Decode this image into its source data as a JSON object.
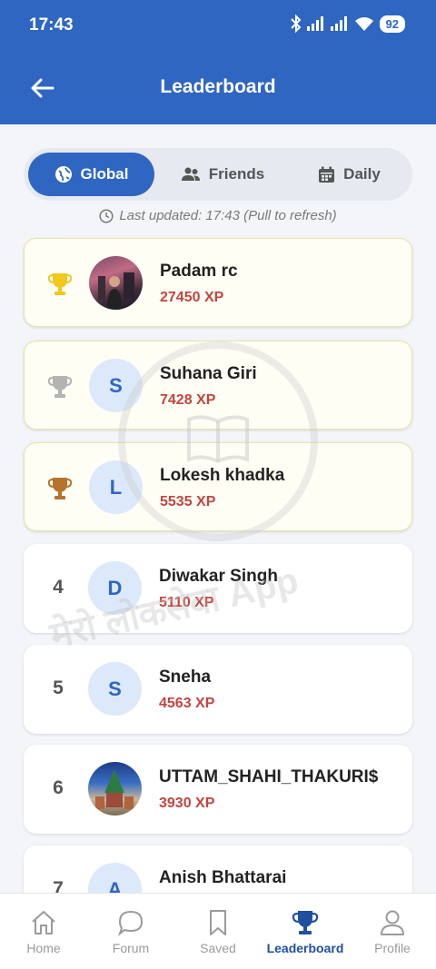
{
  "status_bar": {
    "time": "17:43",
    "battery": "92"
  },
  "app_bar": {
    "title": "Leaderboard"
  },
  "tabs": [
    {
      "label": "Global",
      "active": true
    },
    {
      "label": "Friends",
      "active": false
    },
    {
      "label": "Daily",
      "active": false
    }
  ],
  "last_updated": "Last updated: 17:43 (Pull to refresh)",
  "leaderboard": [
    {
      "rank": "1",
      "trophy": "gold-trophy-icon",
      "avatar": "photo",
      "initial": "",
      "name": "Padam rc",
      "xp": "27450 XP"
    },
    {
      "rank": "2",
      "trophy": "silver-trophy-icon",
      "avatar": "initial",
      "initial": "S",
      "name": "Suhana Giri",
      "xp": "7428 XP"
    },
    {
      "rank": "3",
      "trophy": "bronze-trophy-icon",
      "avatar": "initial",
      "initial": "L",
      "name": "Lokesh khadka",
      "xp": "5535 XP"
    },
    {
      "rank": "4",
      "trophy": "",
      "avatar": "initial",
      "initial": "D",
      "name": "Diwakar Singh",
      "xp": "5110 XP"
    },
    {
      "rank": "5",
      "trophy": "",
      "avatar": "initial",
      "initial": "S",
      "name": "Sneha",
      "xp": "4563 XP"
    },
    {
      "rank": "6",
      "trophy": "",
      "avatar": "photo",
      "initial": "",
      "name": "UTTAM_SHAHI_THAKURI$",
      "xp": "3930 XP"
    },
    {
      "rank": "7",
      "trophy": "",
      "avatar": "initial",
      "initial": "A",
      "name": "Anish Bhattarai",
      "xp": ""
    }
  ],
  "watermark": {
    "text": "मेरो लोकसेवा App"
  },
  "bottom_nav": [
    {
      "label": "Home",
      "icon": "home-icon",
      "active": false
    },
    {
      "label": "Forum",
      "icon": "forum-icon",
      "active": false
    },
    {
      "label": "Saved",
      "icon": "bookmark-icon",
      "active": false
    },
    {
      "label": "Leaderboard",
      "icon": "trophy-icon",
      "active": true
    },
    {
      "label": "Profile",
      "icon": "profile-icon",
      "active": false
    }
  ],
  "colors": {
    "primary": "#2f66c2",
    "xp": "#c4443f",
    "gold": "#f2c81c",
    "silver": "#b3b3b3",
    "bronze": "#b5732c",
    "nav_active": "#1f4f9f"
  }
}
